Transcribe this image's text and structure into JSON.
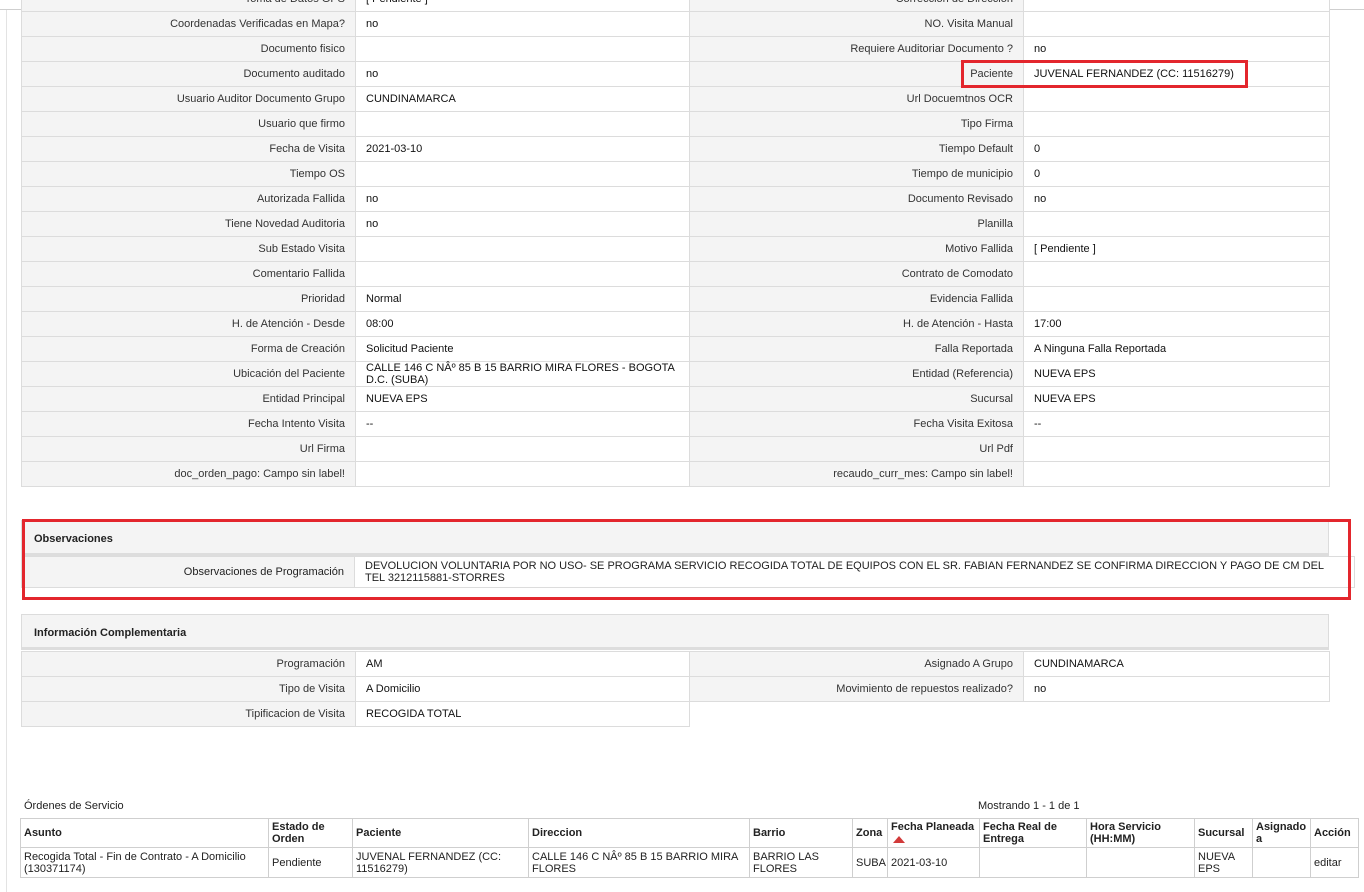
{
  "detail_rows": [
    {
      "l1": "Toma de Datos GPS",
      "v1": "[ Pendiente ]",
      "l2": "Corrección de Dirección",
      "v2": ""
    },
    {
      "l1": "Coordenadas Verificadas en Mapa?",
      "v1": "no",
      "l2": "NO. Visita Manual",
      "v2": ""
    },
    {
      "l1": "Documento fisico",
      "v1": "",
      "l2": "Requiere Auditoriar Documento ?",
      "v2": "no"
    },
    {
      "l1": "Documento auditado",
      "v1": "no",
      "l2": "Paciente",
      "v2": "JUVENAL FERNANDEZ (CC: 11516279)"
    },
    {
      "l1": "Usuario Auditor Documento Grupo",
      "v1": "CUNDINAMARCA",
      "l2": "Url Docuemtnos OCR",
      "v2": ""
    },
    {
      "l1": "Usuario que firmo",
      "v1": "",
      "l2": "Tipo Firma",
      "v2": ""
    },
    {
      "l1": "Fecha de Visita",
      "v1": "2021-03-10",
      "l2": "Tiempo Default",
      "v2": "0"
    },
    {
      "l1": "Tiempo OS",
      "v1": "",
      "l2": "Tiempo de municipio",
      "v2": "0"
    },
    {
      "l1": "Autorizada Fallida",
      "v1": "no",
      "l2": "Documento Revisado",
      "v2": "no"
    },
    {
      "l1": "Tiene Novedad Auditoria",
      "v1": "no",
      "l2": "Planilla",
      "v2": ""
    },
    {
      "l1": "Sub Estado Visita",
      "v1": "",
      "l2": "Motivo Fallida",
      "v2": "[ Pendiente ]"
    },
    {
      "l1": "Comentario Fallida",
      "v1": "",
      "l2": "Contrato de Comodato",
      "v2": ""
    },
    {
      "l1": "Prioridad",
      "v1": "Normal",
      "l2": "Evidencia Fallida",
      "v2": ""
    },
    {
      "l1": "H. de Atención - Desde",
      "v1": "08:00",
      "l2": "H. de Atención - Hasta",
      "v2": "17:00"
    },
    {
      "l1": "Forma de Creación",
      "v1": "Solicitud Paciente",
      "l2": "Falla Reportada",
      "v2": "A Ninguna Falla Reportada"
    },
    {
      "l1": "Ubicación del Paciente",
      "v1": "CALLE 146 C NÂº 85 B 15 BARRIO MIRA FLORES - BOGOTA D.C. (SUBA)",
      "l2": "Entidad (Referencia)",
      "v2": "NUEVA EPS"
    },
    {
      "l1": "Entidad Principal",
      "v1": "NUEVA EPS",
      "l2": "Sucursal",
      "v2": "NUEVA EPS"
    },
    {
      "l1": "Fecha Intento Visita",
      "v1": "--",
      "l2": "Fecha Visita Exitosa",
      "v2": "--"
    },
    {
      "l1": "Url Firma",
      "v1": "",
      "l2": "Url Pdf",
      "v2": ""
    },
    {
      "l1": "doc_orden_pago: Campo sin label!",
      "v1": "",
      "l2": "recaudo_curr_mes: Campo sin label!",
      "v2": ""
    }
  ],
  "observaciones": {
    "title": "Observaciones",
    "label": "Observaciones de Programación",
    "value": "DEVOLUCION VOLUNTARIA POR NO USO- SE PROGRAMA SERVICIO RECOGIDA TOTAL DE EQUIPOS CON EL SR. FABIAN FERNANDEZ SE CONFIRMA DIRECCION Y PAGO DE CM DEL TEL 3212115881-STORRES"
  },
  "complementaria": {
    "title": "Información Complementaria",
    "rows": [
      {
        "l1": "Programación",
        "v1": "AM",
        "l2": "Asignado A Grupo",
        "v2": "CUNDINAMARCA"
      },
      {
        "l1": "Tipo de Visita",
        "v1": "A Domicilio",
        "l2": "Movimiento de repuestos realizado?",
        "v2": "no"
      },
      {
        "l1": "Tipificacion de Visita",
        "v1": "RECOGIDA TOTAL"
      }
    ]
  },
  "orders": {
    "title": "Órdenes de Servicio",
    "count": "Mostrando 1 - 1 de 1",
    "columns": [
      "Asunto",
      "Estado de Orden",
      "Paciente",
      "Direccion",
      "Barrio",
      "Zona",
      "Fecha Planeada",
      "Fecha Real de Entrega",
      "Hora Servicio (HH:MM)",
      "Sucursal",
      "Asignado a",
      "Acción"
    ],
    "rows": [
      [
        "Recogida Total - Fin de Contrato - A Domicilio (130371174)",
        "Pendiente",
        "JUVENAL FERNANDEZ (CC: 11516279)",
        "CALLE 146 C NÂº 85 B 15 BARRIO MIRA FLORES",
        "BARRIO LAS FLORES",
        "SUBA",
        "2021-03-10",
        "",
        "",
        "NUEVA EPS",
        "",
        "editar"
      ]
    ]
  },
  "colors": {
    "highlight": "#e3262d",
    "sort_arrow": "#d23a3a",
    "label_bg": "#f4f4f4"
  },
  "icons": {
    "sort": "sort-ascending-icon"
  }
}
